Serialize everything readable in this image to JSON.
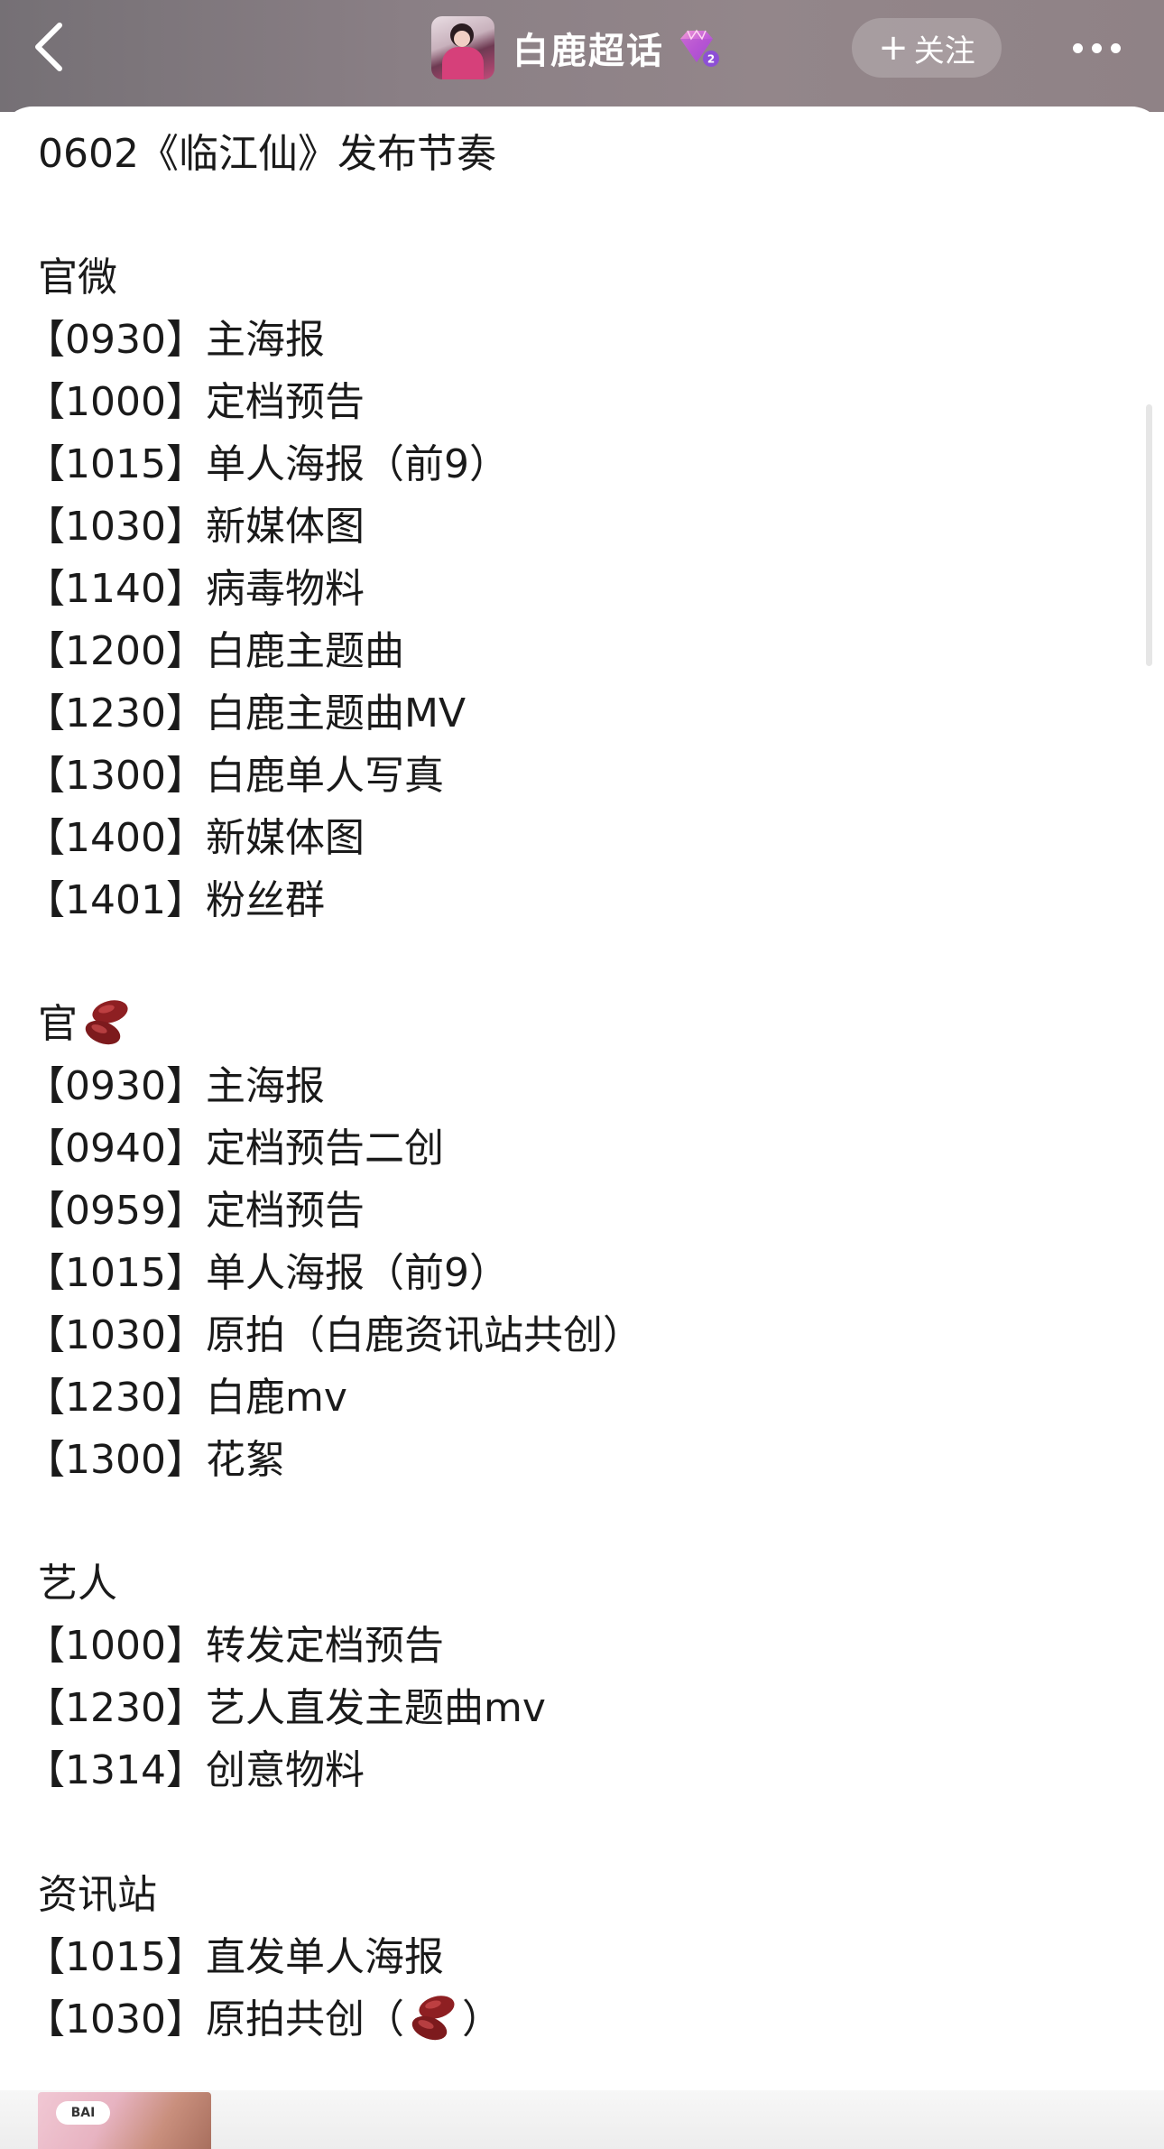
{
  "header": {
    "title": "白鹿超话",
    "follow_label": "关注",
    "icons": [
      "back-chevron-icon",
      "avatar",
      "diamond-level-badge-icon",
      "plus-icon",
      "more-dots-icon"
    ]
  },
  "post": {
    "heading": "0602《临江仙》发布节奏",
    "sections": [
      {
        "title": "官微",
        "items": [
          "【0930】主海报",
          "【1000】定档预告",
          "【1015】单人海报（前9）",
          "【1030】新媒体图",
          "【1140】病毒物料",
          "【1200】白鹿主题曲",
          "【1230】白鹿主题曲MV",
          "【1300】白鹿单人写真",
          "【1400】新媒体图",
          "【1401】粉丝群"
        ]
      },
      {
        "title": "官",
        "title_icon": "red-bean-emoji-icon",
        "items": [
          "【0930】主海报",
          "【0940】定档预告二创",
          "【0959】定档预告",
          "【1015】单人海报（前9）",
          "【1030】原拍（白鹿资讯站共创）",
          "【1230】白鹿mv",
          "【1300】花絮"
        ]
      },
      {
        "title": "艺人",
        "items": [
          "【1000】转发定档预告",
          "【1230】艺人直发主题曲mv",
          "【1314】创意物料"
        ]
      },
      {
        "title": "资讯站",
        "items": [
          "【1015】直发单人海报"
        ],
        "last_item_prefix": "【1030】原拍共创（",
        "last_item_suffix": "）"
      }
    ],
    "thumbnail_tag": "BAI"
  },
  "colors": {
    "header_bg": "#8a7f85",
    "text": "#1a1a1a",
    "badge_purple": "#b55bd6"
  }
}
